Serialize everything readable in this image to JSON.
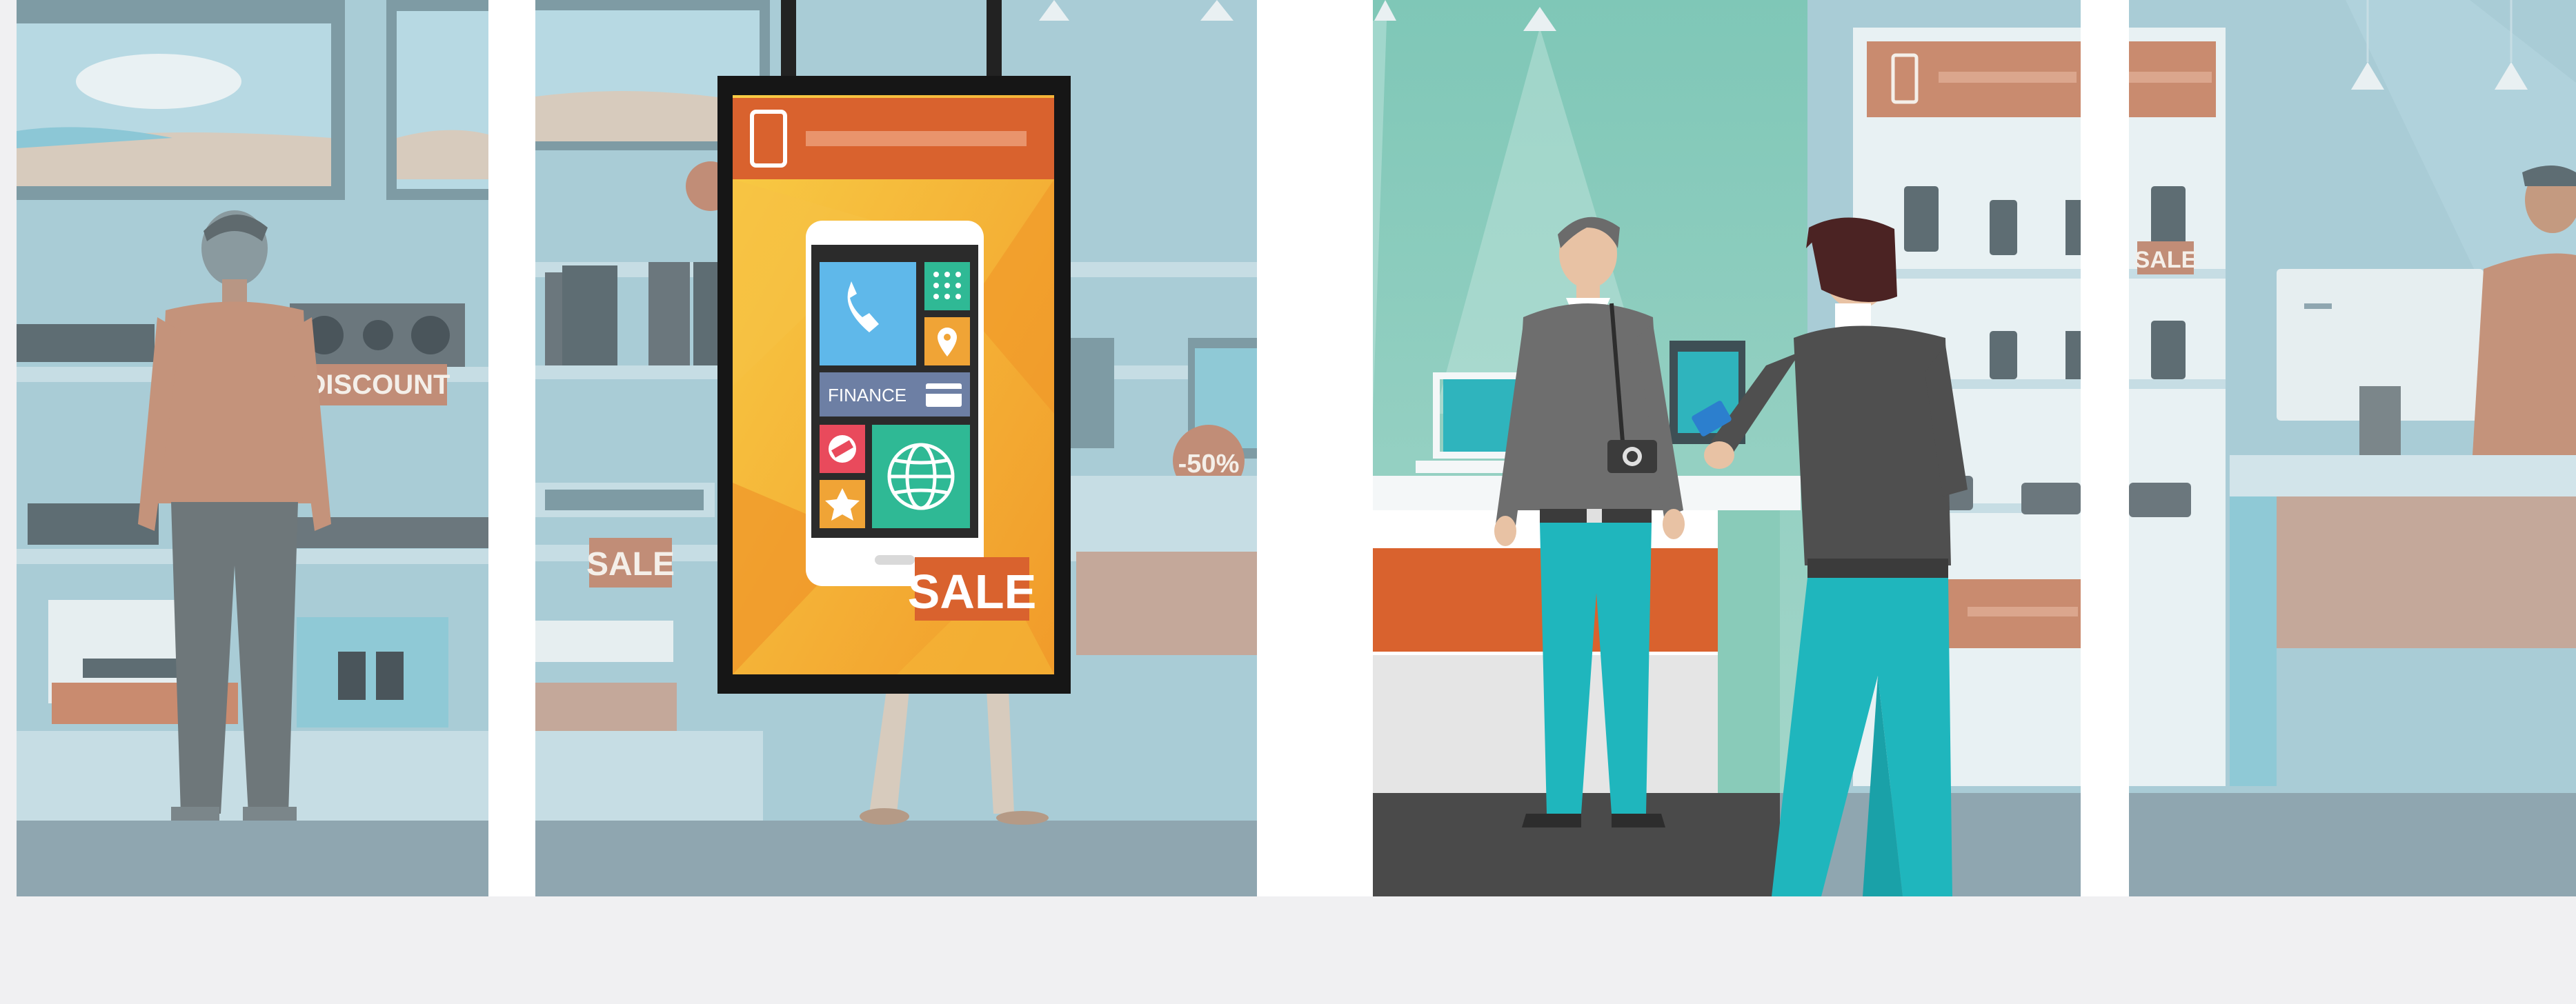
{
  "colors": {
    "background": "#f0f0f2",
    "store_wall": "#a9ccd6",
    "store_teal": "#8fcbbf",
    "accent_orange": "#d9622e",
    "screen_yellow": "#f5bb3a",
    "pants_teal": "#1fb6bd",
    "floor_dark": "#4a4a4a"
  },
  "scene": {
    "panels": [
      {
        "name": "left-window",
        "shelf_sign": "DISCOUNT"
      },
      {
        "name": "center-left-window",
        "shelf_sign": "SALE",
        "price_tag": "-50%"
      },
      {
        "name": "center-right-window"
      },
      {
        "name": "right-window",
        "shelf_sign": "SALE"
      }
    ],
    "kiosk": {
      "tile_label": "FINANCE",
      "sale_badge": "SALE"
    }
  }
}
